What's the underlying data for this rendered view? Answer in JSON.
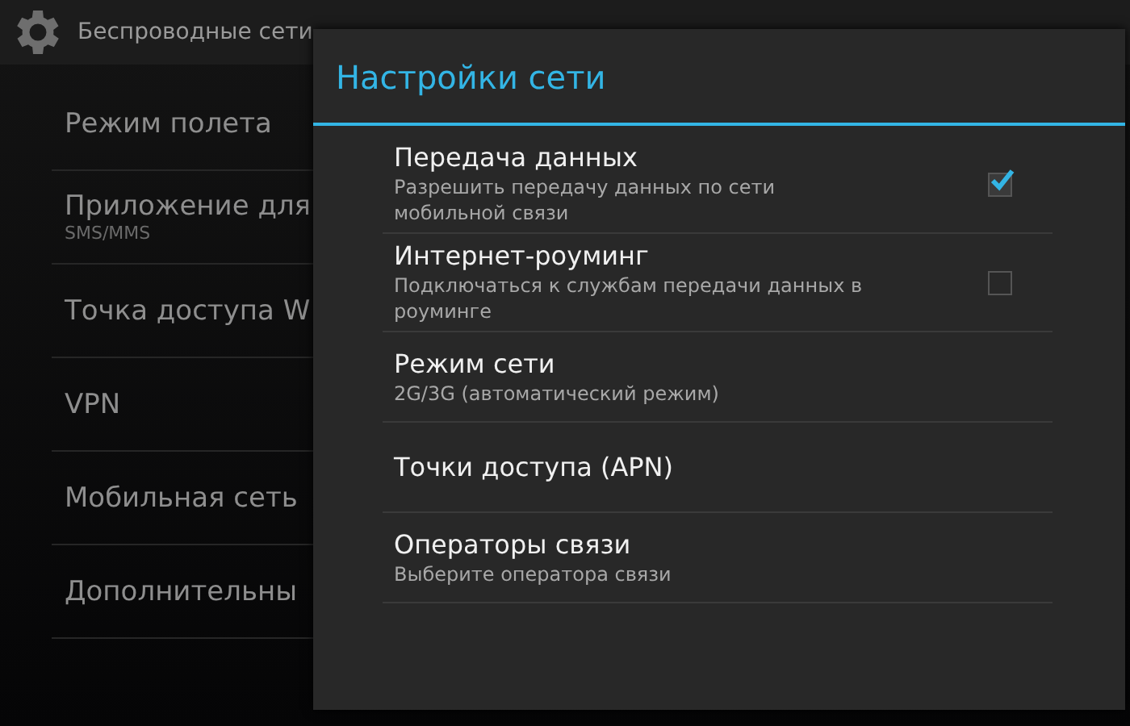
{
  "header": {
    "title": "Беспроводные сети"
  },
  "settings_list": [
    {
      "title": "Режим полета"
    },
    {
      "title": "Приложение для",
      "subtitle": "SMS/MMS"
    },
    {
      "title": "Точка доступа W"
    },
    {
      "title": "VPN"
    },
    {
      "title": "Мобильная сеть"
    },
    {
      "title": "Дополнительны"
    }
  ],
  "dialog": {
    "title": "Настройки сети",
    "items": [
      {
        "kind": "checkbox",
        "title": "Передача данных",
        "subtitle": "Разрешить передачу данных по сети мобильной связи",
        "checked": true
      },
      {
        "kind": "checkbox",
        "title": "Интернет-роуминг",
        "subtitle": "Подключаться к службам передачи данных в роуминге",
        "checked": false
      },
      {
        "kind": "plain",
        "title": "Режим сети",
        "subtitle": "2G/3G (автоматический режим)"
      },
      {
        "kind": "plain",
        "title": "Точки доступа (APN)"
      },
      {
        "kind": "plain",
        "title": "Операторы связи",
        "subtitle": "Выберите оператора связи"
      }
    ]
  }
}
